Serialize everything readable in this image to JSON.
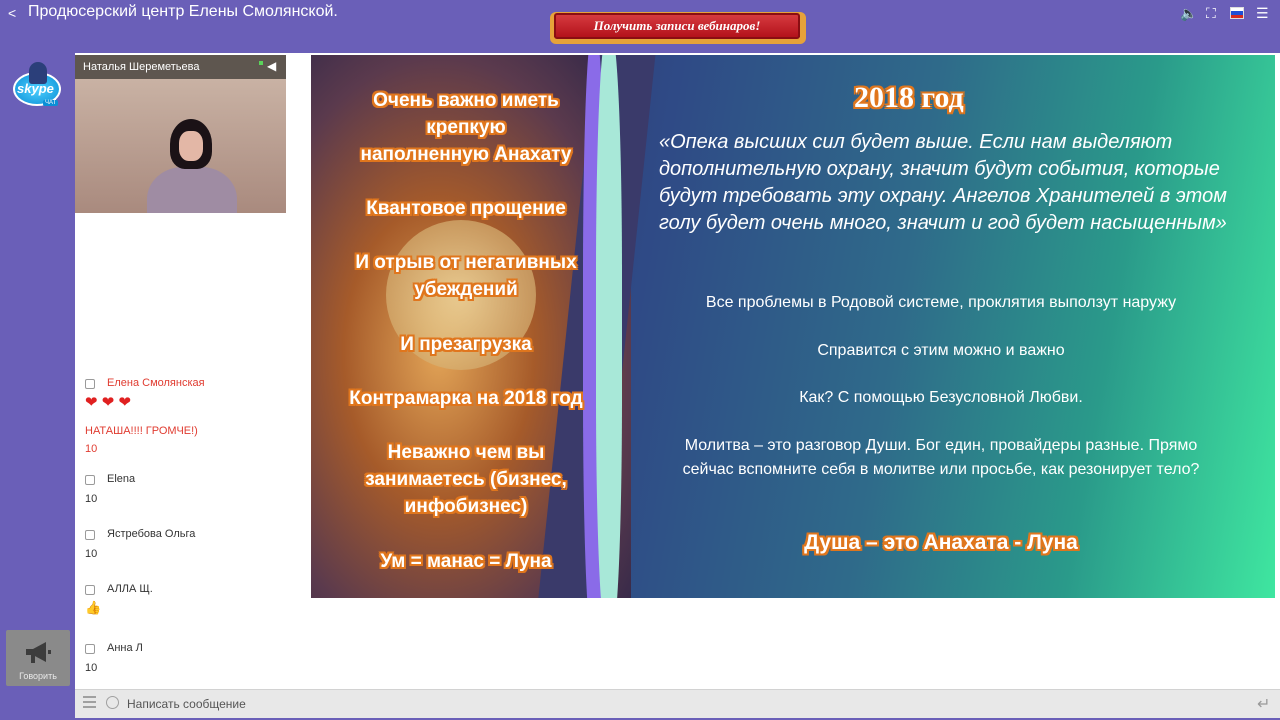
{
  "app": {
    "title": "Продюсерский центр Елены Смолянской.",
    "promo_button": "Получить записи вебинаров!"
  },
  "top_icons": [
    "share-icon",
    "volume-icon",
    "fullscreen-icon",
    "russian-flag-icon",
    "menu-icon"
  ],
  "skype": {
    "word": "skype",
    "tag": "ЧАТ"
  },
  "speak": {
    "label": "Говорить"
  },
  "video": {
    "name": "Наталья Шереметьева"
  },
  "chat": {
    "messages": [
      {
        "author": "Елена Смолянская",
        "hearts": "❤ ❤ ❤",
        "text": "НАТАША!!!! ГРОМЧЕ!)",
        "num": "10"
      },
      {
        "author": "Elena",
        "num": "10"
      },
      {
        "author": "Ястребова Ольга",
        "num": "10"
      },
      {
        "author": "АЛЛА Щ.",
        "thumb": "👍"
      },
      {
        "author": "Анна Л",
        "num": "10"
      }
    ]
  },
  "slide": {
    "left_lines": [
      "Очень важно иметь",
      "крепкую",
      "наполненную Анахату",
      "Квантовое прощение",
      "И отрыв от негативных",
      "убеждений",
      "И презагрузка",
      "Контрамарка на 2018 год",
      "Неважно чем вы",
      "занимаетесь (бизнес,",
      "инфобизнес)",
      "Ум  = манас = Луна"
    ],
    "year": "2018 год",
    "quote": "«Опека высших сил будет выше. Если нам выделяют дополнительную охрану, значит будут события, которые будут требовать эту охрану. Ангелов Хранителей в этом голу будет очень много, значит и год будет насыщенным»",
    "body": [
      "Все проблемы в Родовой системе, проклятия выползут наружу",
      "Справится с этим можно и важно",
      "Как? С помощью Безусловной Любви.",
      "Молитва – это разговор Души. Бог един, провайдеры разные. Прямо сейчас вспомните себя в молитве или просьбе, как резонирует тело?"
    ],
    "final": "Душа – это Анахата - Луна"
  },
  "message_bar": {
    "placeholder": "Написать сообщение"
  }
}
